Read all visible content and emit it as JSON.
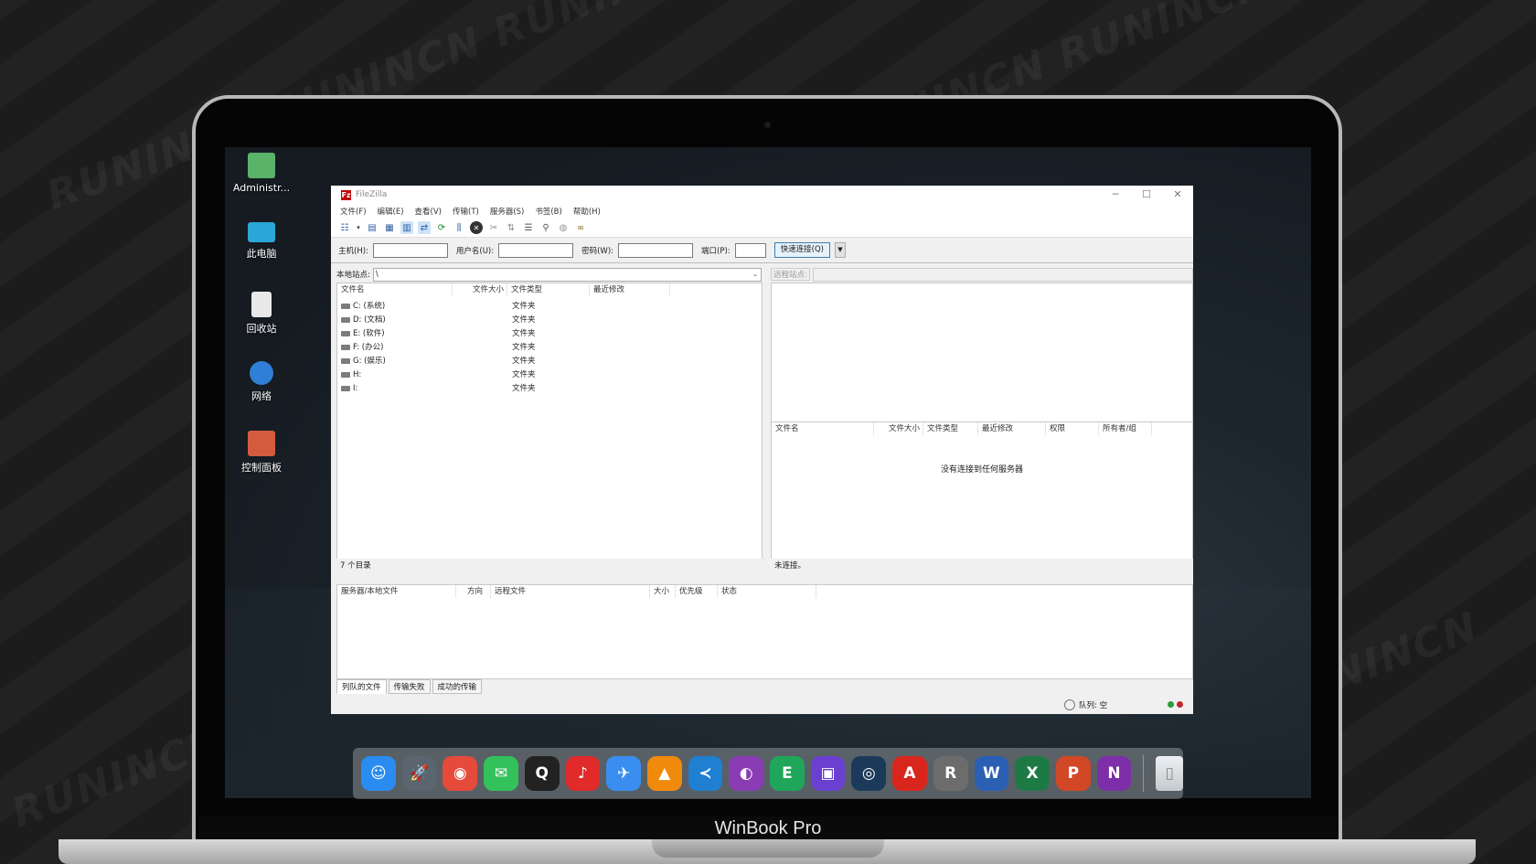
{
  "brand": "WinBook Pro",
  "desktop_icons": [
    {
      "label": "Administr...",
      "icon": "user-folder-icon",
      "color": "#5bb36a"
    },
    {
      "label": "此电脑",
      "icon": "computer-icon",
      "color": "#2aa7d6"
    },
    {
      "label": "回收站",
      "icon": "recycle-bin-icon",
      "color": "#e8e8e8"
    },
    {
      "label": "网络",
      "icon": "network-icon",
      "color": "#2f7fd6"
    },
    {
      "label": "控制面板",
      "icon": "control-panel-icon",
      "color": "#d45b3e"
    }
  ],
  "window": {
    "title": "FileZilla",
    "menu": [
      "文件(F)",
      "编辑(E)",
      "查看(V)",
      "传输(T)",
      "服务器(S)",
      "书签(B)",
      "帮助(H)"
    ],
    "quickconnect": {
      "host_label": "主机(H):",
      "user_label": "用户名(U):",
      "pass_label": "密码(W):",
      "port_label": "端口(P):",
      "connect_label": "快速连接(Q)"
    },
    "local": {
      "site_label": "本地站点:",
      "path": "\\",
      "columns": [
        "文件名",
        "文件大小",
        "文件类型",
        "最近修改"
      ],
      "rows": [
        {
          "name": "C: (系统)",
          "type": "文件夹"
        },
        {
          "name": "D: (文档)",
          "type": "文件夹"
        },
        {
          "name": "E: (软件)",
          "type": "文件夹"
        },
        {
          "name": "F: (办公)",
          "type": "文件夹"
        },
        {
          "name": "G: (娱乐)",
          "type": "文件夹"
        },
        {
          "name": "H:",
          "type": "文件夹"
        },
        {
          "name": "I:",
          "type": "文件夹"
        }
      ],
      "status": "7 个目录"
    },
    "remote": {
      "site_label": "远程站点:",
      "columns": [
        "文件名",
        "文件大小",
        "文件类型",
        "最近修改",
        "权限",
        "所有者/组"
      ],
      "empty_message": "没有连接到任何服务器",
      "status": "未连接。"
    },
    "queue": {
      "columns": [
        "服务器/本地文件",
        "方向",
        "远程文件",
        "大小",
        "优先级",
        "状态"
      ],
      "tabs": [
        "列队的文件",
        "传输失败",
        "成功的传输"
      ],
      "queue_status": "队列: 空"
    }
  },
  "dock_apps": [
    {
      "name": "finder",
      "glyph": "☺",
      "color": "#2a8cf0"
    },
    {
      "name": "launchpad",
      "glyph": "🚀",
      "color": "#5b6570"
    },
    {
      "name": "chrome",
      "glyph": "◉",
      "color": "#e64a3b"
    },
    {
      "name": "wechat",
      "glyph": "✉",
      "color": "#32c15a"
    },
    {
      "name": "qq",
      "glyph": "Q",
      "color": "#222"
    },
    {
      "name": "netease-music",
      "glyph": "♪",
      "color": "#e12a2a"
    },
    {
      "name": "feishu",
      "glyph": "✈",
      "color": "#3a8ef0"
    },
    {
      "name": "vlc",
      "glyph": "▲",
      "color": "#f08a0c"
    },
    {
      "name": "vscode",
      "glyph": "≺",
      "color": "#1f7fd1"
    },
    {
      "name": "github",
      "glyph": "◐",
      "color": "#8a3cb5"
    },
    {
      "name": "evernote",
      "glyph": "E",
      "color": "#20a65a"
    },
    {
      "name": "twitch",
      "glyph": "▣",
      "color": "#6b3fcf"
    },
    {
      "name": "steam",
      "glyph": "◎",
      "color": "#1b3a5a"
    },
    {
      "name": "acrobat",
      "glyph": "A",
      "color": "#d9261c"
    },
    {
      "name": "rhino",
      "glyph": "R",
      "color": "#6c6c6c"
    },
    {
      "name": "word",
      "glyph": "W",
      "color": "#2b5fb4"
    },
    {
      "name": "excel",
      "glyph": "X",
      "color": "#1e7a45"
    },
    {
      "name": "powerpoint",
      "glyph": "P",
      "color": "#d24726"
    },
    {
      "name": "onenote",
      "glyph": "N",
      "color": "#7e2ea8"
    },
    {
      "name": "trash",
      "glyph": "▯",
      "color": "#cfd4d8"
    }
  ]
}
